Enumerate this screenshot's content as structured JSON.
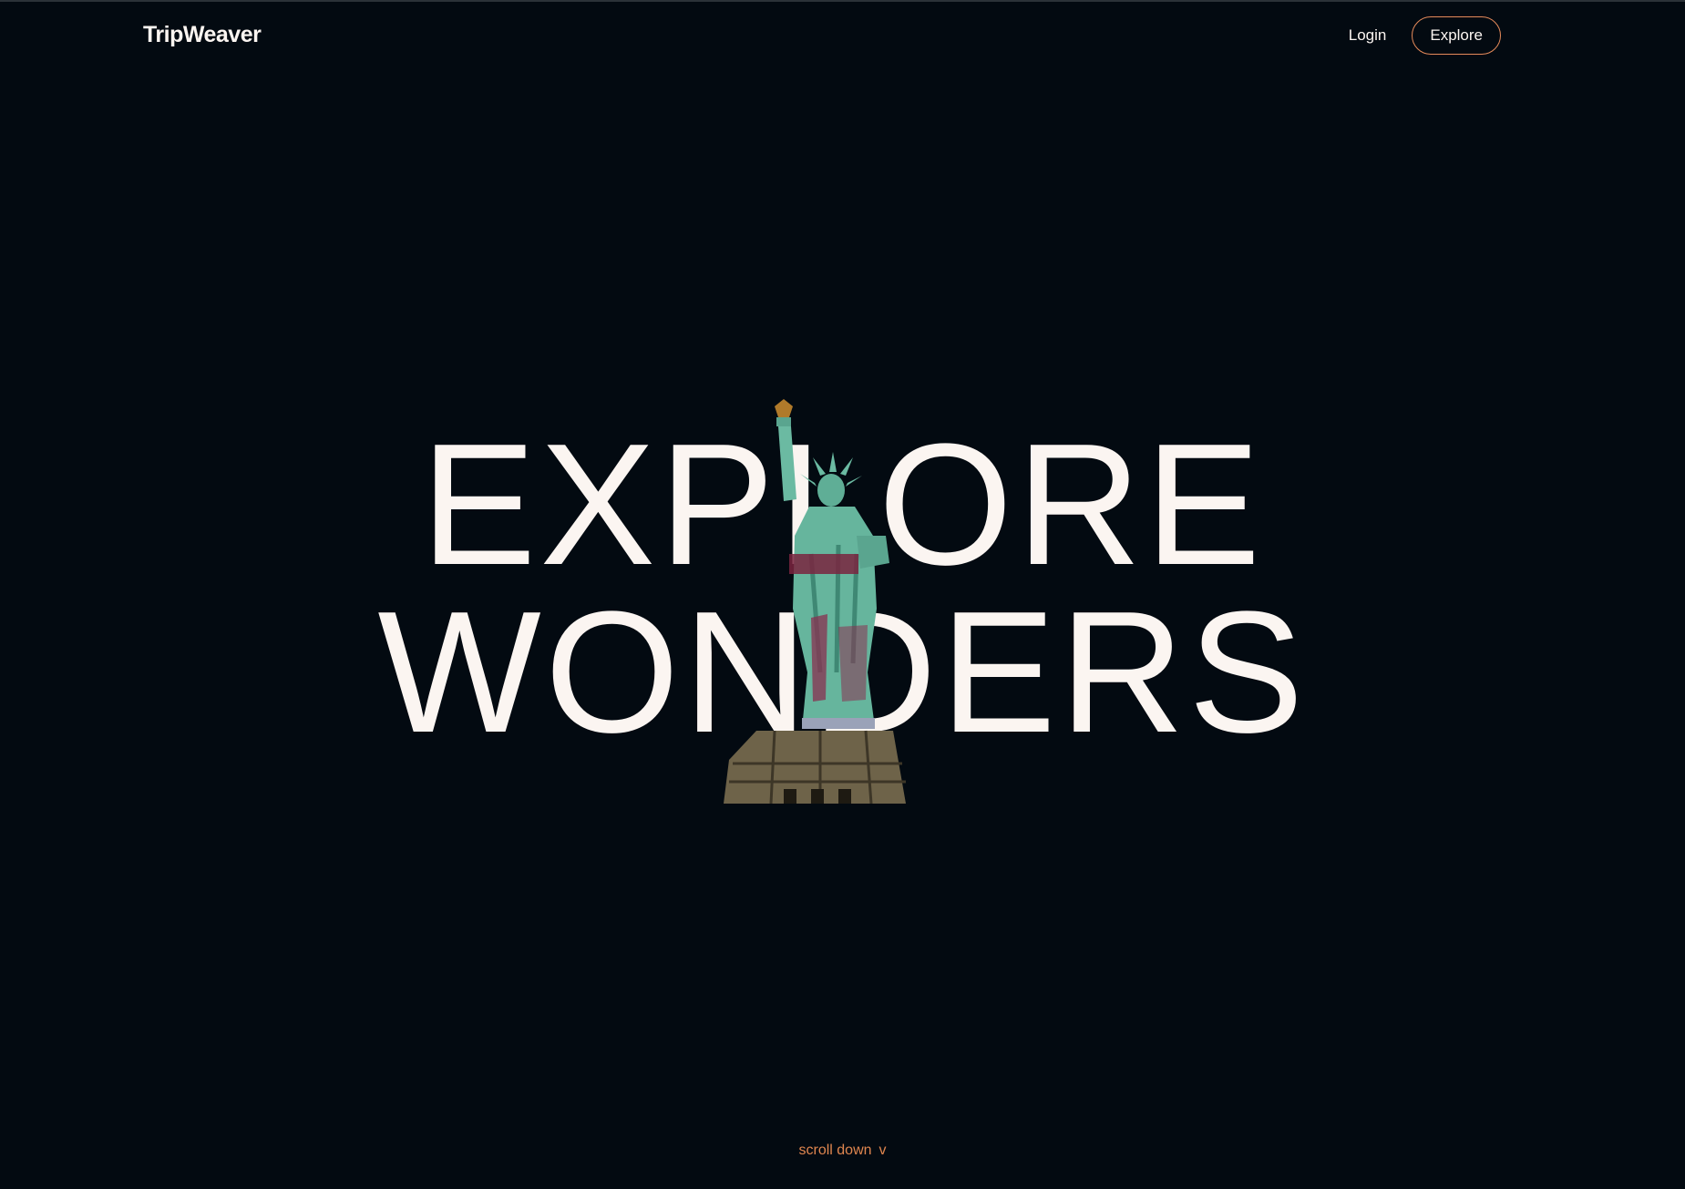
{
  "header": {
    "brand": "TripWeaver",
    "nav": {
      "login_label": "Login",
      "explore_label": "Explore"
    }
  },
  "hero": {
    "line1": "EXPLORE",
    "line2": "WONDERS",
    "image_icon": "statue-of-liberty"
  },
  "footer": {
    "scroll_label": "scroll down",
    "scroll_chevron": "v"
  },
  "colors": {
    "background": "#030a11",
    "text": "#fbf5f1",
    "accent": "#e58a5a"
  }
}
